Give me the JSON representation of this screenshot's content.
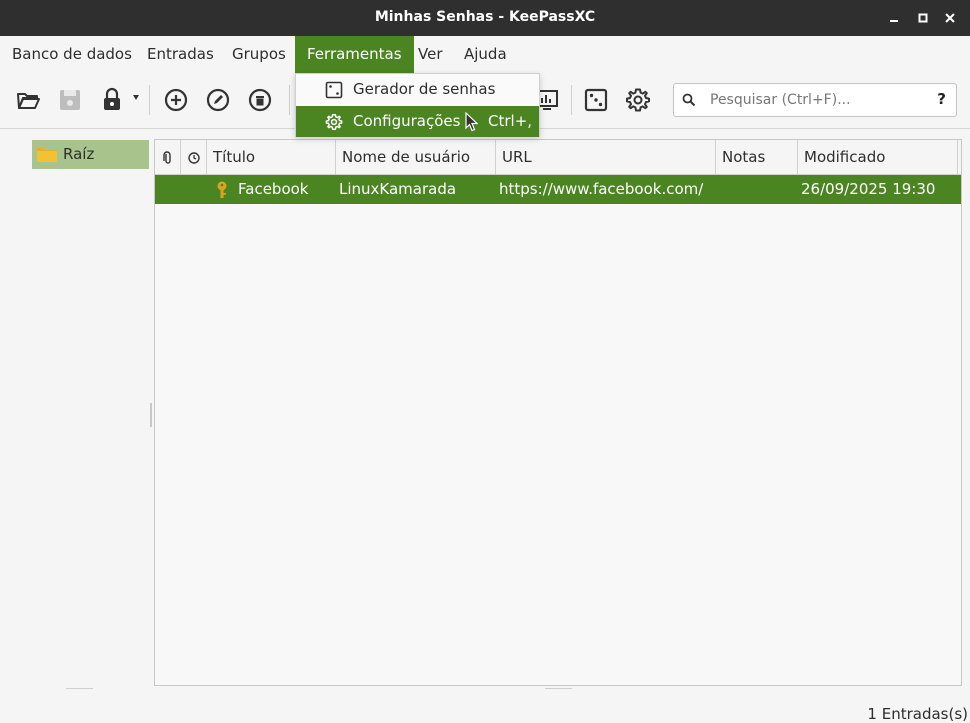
{
  "window": {
    "title": "Minhas Senhas - KeePassXC"
  },
  "menubar": {
    "items": [
      "Banco de dados",
      "Entradas",
      "Grupos",
      "Ferramentas",
      "Ver",
      "Ajuda"
    ],
    "active": "Ferramentas"
  },
  "tools_menu": {
    "items": [
      {
        "label": "Gerador de senhas",
        "shortcut": "",
        "icon": "dice-icon"
      },
      {
        "label": "Configurações",
        "shortcut": "Ctrl+,",
        "icon": "gear-icon"
      }
    ],
    "highlighted": "Configurações"
  },
  "toolbar": {
    "icons": [
      "open-database-icon",
      "save-database-icon",
      "lock-database-icon",
      "add-entry-icon",
      "edit-entry-icon",
      "delete-entry-icon",
      "reports-icon",
      "password-generator-icon",
      "settings-icon"
    ]
  },
  "search": {
    "placeholder": "Pesquisar (Ctrl+F)...",
    "value": "",
    "help": "?"
  },
  "groups": [
    {
      "name": "Raíz",
      "selected": true
    }
  ],
  "entries_table": {
    "columns": [
      "Título",
      "Nome de usuário",
      "URL",
      "Notas",
      "Modificado"
    ],
    "rows": [
      {
        "title": "Facebook",
        "username": "LinuxKamarada",
        "url": "https://www.facebook.com/",
        "notes": "",
        "modified": "26/09/2025 19:30",
        "selected": true
      }
    ]
  },
  "status": {
    "entry_count": "1 Entradas(s)"
  },
  "colors": {
    "accent": "#4b8521",
    "group_selected": "#a8c48c",
    "titlebar": "#2f2f2f"
  }
}
